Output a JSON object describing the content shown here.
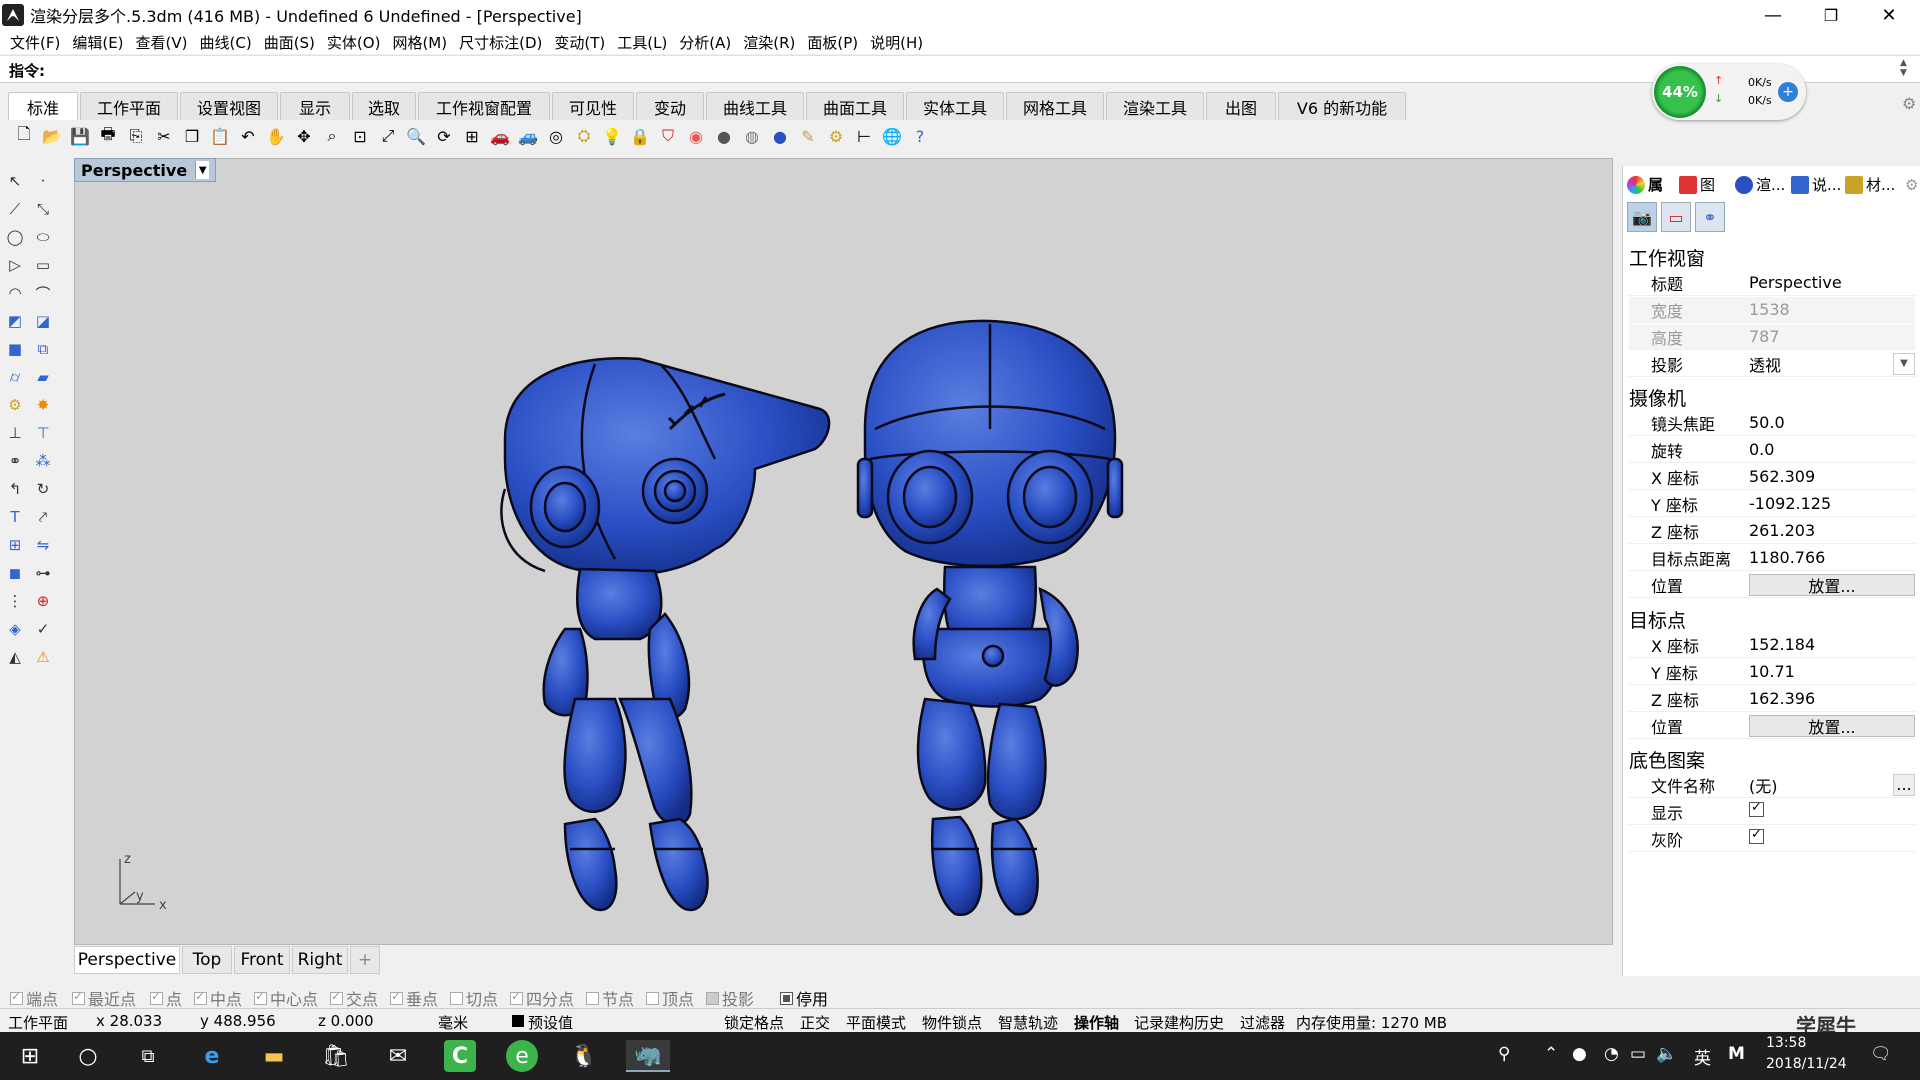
{
  "window": {
    "title": "渲染分层多个.5.3dm (416 MB) - Undefined 6 Undefined - [Perspective]",
    "minimize": "—",
    "maximize": "❐",
    "close": "✕"
  },
  "menu": [
    "文件(F)",
    "编辑(E)",
    "查看(V)",
    "曲线(C)",
    "曲面(S)",
    "实体(O)",
    "网格(M)",
    "尺寸标注(D)",
    "变动(T)",
    "工具(L)",
    "分析(A)",
    "渲染(R)",
    "面板(P)",
    "说明(H)"
  ],
  "command": {
    "label": "指令:",
    "value": ""
  },
  "tabs": [
    "标准",
    "工作平面",
    "设置视图",
    "显示",
    "选取",
    "工作视窗配置",
    "可见性",
    "变动",
    "曲线工具",
    "曲面工具",
    "实体工具",
    "网格工具",
    "渲染工具",
    "出图",
    "V6 的新功能"
  ],
  "active_tab": "标准",
  "network": {
    "percent": "44%",
    "up": "0K/s",
    "down": "0K/s"
  },
  "viewport": {
    "title": "Perspective",
    "axis": {
      "z": "z",
      "y": "y",
      "x": "x"
    },
    "model_color": "#2a4fc4"
  },
  "view_tabs": [
    "Perspective",
    "Top",
    "Front",
    "Right"
  ],
  "view_tab_add": "+",
  "osnaps": [
    {
      "label": "端点",
      "on": false
    },
    {
      "label": "最近点",
      "on": false
    },
    {
      "label": "点",
      "on": false
    },
    {
      "label": "中点",
      "on": false
    },
    {
      "label": "中心点",
      "on": false
    },
    {
      "label": "交点",
      "on": false
    },
    {
      "label": "垂点",
      "on": false
    },
    {
      "label": "切点",
      "on": false
    },
    {
      "label": "四分点",
      "on": false
    },
    {
      "label": "节点",
      "on": false
    },
    {
      "label": "顶点",
      "on": false
    },
    {
      "label": "投影",
      "on": false
    },
    {
      "label": "停用",
      "on": true
    }
  ],
  "status": {
    "cplane": "工作平面",
    "x": "x 28.033",
    "y": "y 488.956",
    "z": "z 0.000",
    "unit": "毫米",
    "layer": "预设值",
    "grid_snap": "锁定格点",
    "ortho": "正交",
    "planar": "平面模式",
    "osnap": "物件锁点",
    "smarttrack": "智慧轨迹",
    "gumball": "操作轴",
    "history": "记录建构历史",
    "filter": "过滤器",
    "memory": "内存使用量: 1270 MB"
  },
  "panel": {
    "tabs": [
      "属",
      "图",
      "渲...",
      "说...",
      "材..."
    ],
    "sections": {
      "viewport": "工作视窗",
      "camera": "摄像机",
      "target": "目标点",
      "wallpaper": "底色图案"
    },
    "viewport_rows": [
      {
        "k": "标题",
        "v": "Perspective",
        "dim": false
      },
      {
        "k": "宽度",
        "v": "1538",
        "dim": true
      },
      {
        "k": "高度",
        "v": "787",
        "dim": true
      },
      {
        "k": "投影",
        "v": "透视",
        "dim": false
      }
    ],
    "camera_rows": [
      {
        "k": "镜头焦距",
        "v": "50.0"
      },
      {
        "k": "旋转",
        "v": "0.0"
      },
      {
        "k": "X 座标",
        "v": "562.309"
      },
      {
        "k": "Y 座标",
        "v": "-1092.125"
      },
      {
        "k": "Z 座标",
        "v": "261.203"
      },
      {
        "k": "目标点距离",
        "v": "1180.766"
      }
    ],
    "camera_place": {
      "k": "位置",
      "btn": "放置..."
    },
    "target_rows": [
      {
        "k": "X 座标",
        "v": "152.184"
      },
      {
        "k": "Y 座标",
        "v": "10.71"
      },
      {
        "k": "Z 座标",
        "v": "162.396"
      }
    ],
    "target_place": {
      "k": "位置",
      "btn": "放置..."
    },
    "wallpaper_rows": {
      "filename_k": "文件名称",
      "filename_v": "(无)",
      "browse": "...",
      "show_k": "显示",
      "gray_k": "灰阶"
    }
  },
  "taskbar": {
    "ime": "英",
    "time": "13:58",
    "date": "2018/11/24",
    "watermark": "学犀牛"
  }
}
